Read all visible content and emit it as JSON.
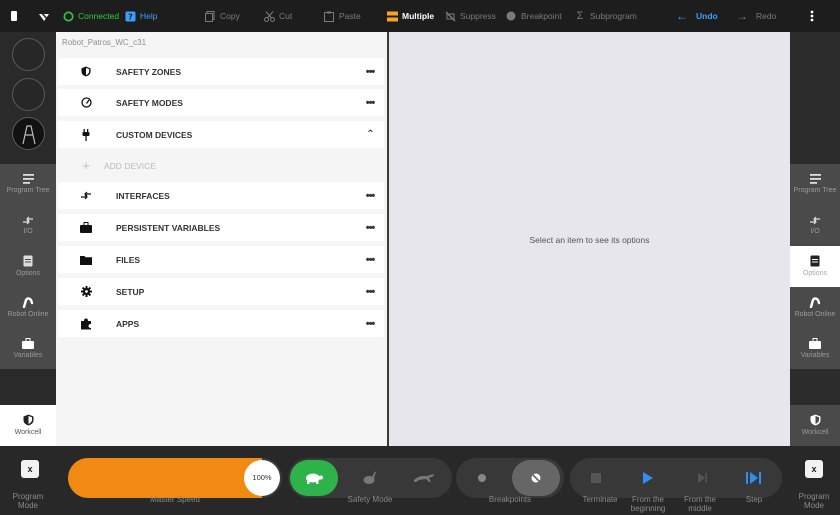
{
  "topbar": {
    "status": "Connected",
    "help": "Help",
    "copy": "Copy",
    "cut": "Cut",
    "paste": "Paste",
    "multiple": "Multiple",
    "suppress": "Suppress",
    "breakpoint": "Breakpoint",
    "subprogram": "Subprogram",
    "undo": "Undo",
    "redo": "Redo"
  },
  "left_rail": {
    "items": [
      {
        "label": "Program Tree",
        "icon": "list-icon"
      },
      {
        "label": "I/O",
        "icon": "io-icon"
      },
      {
        "label": "Options",
        "icon": "options-icon"
      },
      {
        "label": "Robot Online",
        "icon": "robot-arm-icon"
      },
      {
        "label": "Variables",
        "icon": "briefcase-icon"
      },
      {
        "label": "Workcell",
        "icon": "shield-icon"
      }
    ]
  },
  "right_rail": {
    "items": [
      {
        "label": "Program Tree"
      },
      {
        "label": "I/O"
      },
      {
        "label": "Options"
      },
      {
        "label": "Robot Online"
      },
      {
        "label": "Variables"
      },
      {
        "label": "Workcell"
      }
    ]
  },
  "panel": {
    "title": "Robot_Patros_WC_c31",
    "rows": [
      {
        "label": "SAFETY ZONES",
        "icon": "shield-icon"
      },
      {
        "label": "SAFETY MODES",
        "icon": "gauge-icon"
      },
      {
        "label": "CUSTOM DEVICES",
        "icon": "plug-icon"
      },
      {
        "label": "ADD DEVICE",
        "icon": "plus-icon"
      },
      {
        "label": "INTERFACES",
        "icon": "io-icon"
      },
      {
        "label": "PERSISTENT VARIABLES",
        "icon": "briefcase-icon"
      },
      {
        "label": "FILES",
        "icon": "folder-icon"
      },
      {
        "label": "SETUP",
        "icon": "gear-icon"
      },
      {
        "label": "APPS",
        "icon": "puzzle-icon"
      }
    ]
  },
  "right_panel": {
    "hint": "Select an item to see its options"
  },
  "bottombar": {
    "program_mode_left": "Program Mode",
    "master_speed_label": "Master Speed",
    "master_speed_value": "100%",
    "master_speed_fraction": 1.0,
    "safety_mode_label": "Safety Mode",
    "breakpoints_label": "Breakpoints",
    "terminate": "Terminate",
    "from_beginning": "From the beginning",
    "from_middle": "From the middle",
    "step": "Step",
    "program_mode_right": "Program Mode"
  },
  "colors": {
    "accent_orange": "#f18a12",
    "safety_green": "#2db34a",
    "connected_green": "#2ecc40",
    "play_blue": "#2f8ff0"
  }
}
